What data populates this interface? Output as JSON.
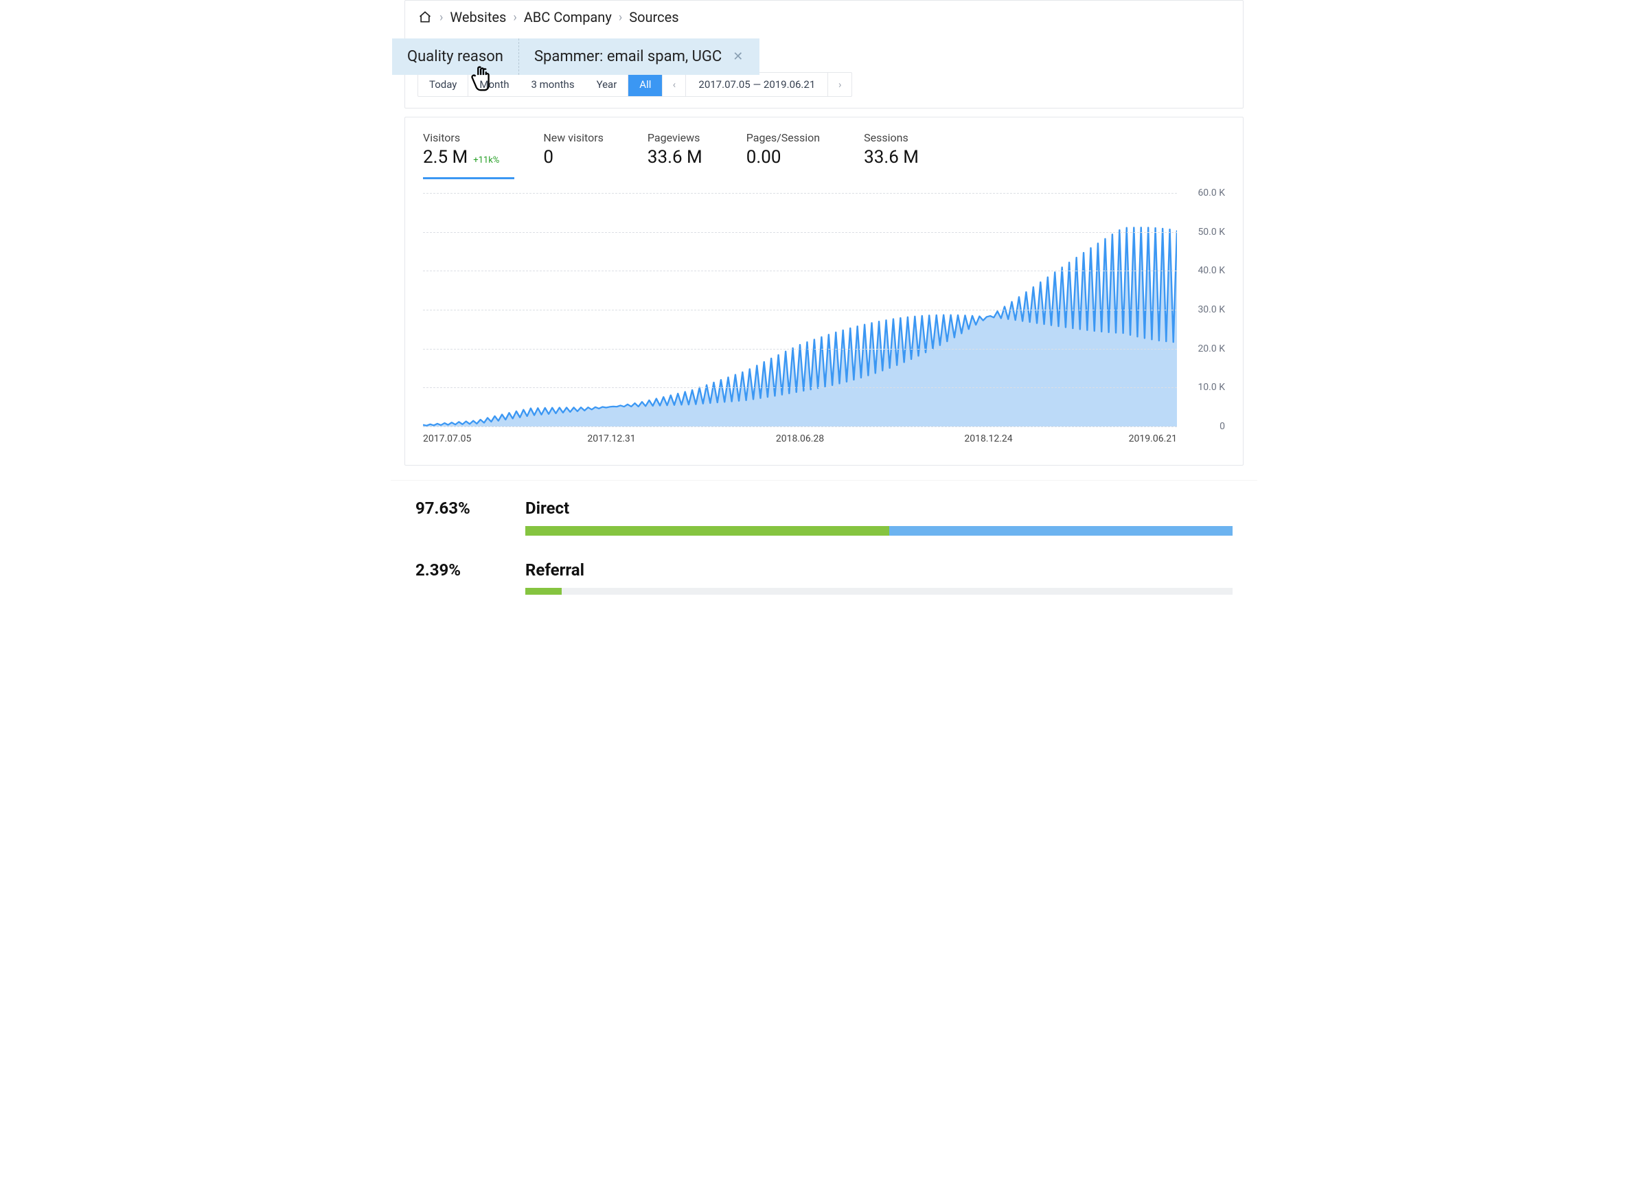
{
  "breadcrumbs": {
    "items": [
      {
        "label": "Websites"
      },
      {
        "label": "ABC Company"
      },
      {
        "label": "Sources"
      }
    ]
  },
  "filter": {
    "label": "Quality reason",
    "value": "Spammer: email spam, UGC"
  },
  "range": {
    "segments": [
      "Today",
      "Month",
      "3 months",
      "Year",
      "All"
    ],
    "active_index": 4,
    "date_label": "2017.07.05 — 2019.06.21"
  },
  "metrics": [
    {
      "label": "Visitors",
      "value": "2.5 M",
      "delta": "+11k%",
      "active": true
    },
    {
      "label": "New visitors",
      "value": "0"
    },
    {
      "label": "Pageviews",
      "value": "33.6 M"
    },
    {
      "label": "Pages/Session",
      "value": "0.00"
    },
    {
      "label": "Sessions",
      "value": "33.6 M"
    }
  ],
  "sources": [
    {
      "name": "Direct",
      "pct": "97.63%",
      "segments": [
        {
          "width": 51.5,
          "color": "#85c440"
        },
        {
          "width": 48.5,
          "color": "#6cb3f0"
        }
      ],
      "track_pct": 100
    },
    {
      "name": "Referral",
      "pct": "2.39%",
      "segments": [
        {
          "width": 100,
          "color": "#85c440"
        }
      ],
      "track_pct": 5.1
    }
  ],
  "chart_data": {
    "type": "area",
    "title": "",
    "xlabel": "",
    "ylabel": "",
    "y_ticks": [
      "0",
      "10.0 K",
      "20.0 K",
      "30.0 K",
      "40.0 K",
      "50.0 K",
      "60.0 K"
    ],
    "ylim": [
      0,
      60000
    ],
    "x_ticks": [
      "2017.07.05",
      "2017.12.31",
      "2018.06.28",
      "2018.12.24",
      "2019.06.21"
    ],
    "series": [
      {
        "name": "Visitors",
        "color": "#3b97f3",
        "trend": [
          {
            "x": "2017.07.05",
            "y": 400
          },
          {
            "x": "2017.09.01",
            "y": 1500
          },
          {
            "x": "2017.10.15",
            "y": 5000
          },
          {
            "x": "2017.12.31",
            "y": 6000
          },
          {
            "x": "2018.03.15",
            "y": 7500
          },
          {
            "x": "2018.05.20",
            "y": 10000
          },
          {
            "x": "2018.06.28",
            "y": 14000
          },
          {
            "x": "2018.08.15",
            "y": 20000
          },
          {
            "x": "2018.10.01",
            "y": 25000
          },
          {
            "x": "2018.11.10",
            "y": 30000
          },
          {
            "x": "2018.12.24",
            "y": 35000
          },
          {
            "x": "2019.02.10",
            "y": 40000
          },
          {
            "x": "2019.04.01",
            "y": 45000
          },
          {
            "x": "2019.05.15",
            "y": 50000
          },
          {
            "x": "2019.06.21",
            "y": 48000
          }
        ],
        "weekly_oscillation_ratio": 0.45,
        "note": "High-frequency weekly dips to roughly 45% of the local trend value, producing comb/spike shape."
      }
    ]
  }
}
